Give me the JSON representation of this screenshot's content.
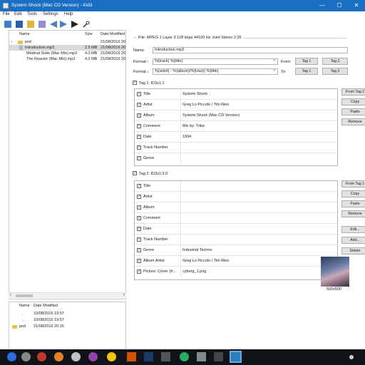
{
  "window": {
    "title": "System Shock (Mac CD Version) - Kid3",
    "minimize": "—",
    "maximize": "☐",
    "close": "✕"
  },
  "menu": [
    "File",
    "Edit",
    "Tools",
    "Settings",
    "Help"
  ],
  "file_tree": {
    "headers": {
      "name": "Name",
      "size": "Size",
      "date": "Date Modified"
    },
    "rows": [
      {
        "name": "psd",
        "size": "",
        "date": "21/08/2016 20"
      },
      {
        "name": "Introduction.mp3",
        "size": "2.5 MB",
        "date": "21/08/2016 20"
      },
      {
        "name": "Medical Suite (Mac Mix).mp3",
        "size": "4.3 MB",
        "date": "21/08/2016 20"
      },
      {
        "name": "The Reactor (Mac Mix).mp3",
        "size": "4.2 MB",
        "date": "21/08/2016 20"
      }
    ]
  },
  "dir_list": {
    "headers": {
      "name": "Name",
      "date": "Date Modified"
    },
    "rows": [
      {
        "name": ".",
        "date": "10/08/2016 19:57"
      },
      {
        "name": "..",
        "date": "10/08/2016 19:57"
      },
      {
        "name": "psd",
        "date": "21/08/2016 20:15"
      }
    ]
  },
  "file_info": "File: MPEG 1 Layer 3 128 kbps 44100 Hz Joint Stereo 2:26",
  "name_label": "Name:",
  "name_value": "Introduction.mp3",
  "format1": {
    "label": "Format:↑",
    "value": "%{track} %{title}",
    "from_label": "From:",
    "btn1": "Tag 1",
    "btn2": "Tag 2"
  },
  "format2": {
    "label": "Format:↓",
    "value": "%{artist} - %{album}/%{track} %{title}",
    "to_label": "To:",
    "btn1": "Tag 1",
    "btn2": "Tag 2"
  },
  "tag1": {
    "label": "Tag 1: ID3v1.1",
    "rows": [
      {
        "field": "Title",
        "value": "System Shock"
      },
      {
        "field": "Artist",
        "value": "Greg Lo Piccolo / Tim Ries"
      },
      {
        "field": "Album",
        "value": "System Shock (Mac CD Version)"
      },
      {
        "field": "Comment",
        "value": "Mix by: Tribe"
      },
      {
        "field": "Date",
        "value": "1994"
      },
      {
        "field": "Track Number",
        "value": ""
      },
      {
        "field": "Genre",
        "value": ""
      }
    ],
    "buttons": [
      "From Tag 2",
      "Copy",
      "Paste",
      "Remove"
    ]
  },
  "tag2": {
    "label": "Tag 2: ID3v2.3.0",
    "rows": [
      {
        "field": "Title",
        "value": ""
      },
      {
        "field": "Artist",
        "value": ""
      },
      {
        "field": "Album",
        "value": ""
      },
      {
        "field": "Comment",
        "value": ""
      },
      {
        "field": "Date",
        "value": ""
      },
      {
        "field": "Track Number",
        "value": ""
      },
      {
        "field": "Genre",
        "value": "Industrial Techno"
      },
      {
        "field": "Album Artist",
        "value": "Greg Lo Piccolo / Tim Ries"
      },
      {
        "field": "Picture: Cover (fr...",
        "value": "cyborg_1.png"
      }
    ],
    "buttons": [
      "From Tag 1",
      "Copy",
      "Paste",
      "Remove",
      "Edit...",
      "Add...",
      "Delete"
    ]
  },
  "cover_size": "500x500",
  "colors": {
    "titlebar": "#1b6fc2",
    "taskbar": "#101418",
    "folder": "#e8c04c"
  }
}
